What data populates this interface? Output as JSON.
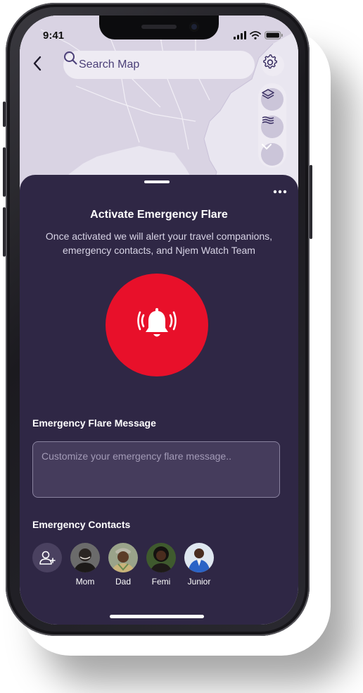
{
  "status": {
    "time": "9:41"
  },
  "header": {
    "search_placeholder": "Search Map",
    "icons": [
      "back-chevron-icon",
      "search-icon",
      "settings-gear-icon",
      "layers-icon",
      "wind-icon",
      "chevron-down-icon"
    ]
  },
  "sheet": {
    "title": "Activate Emergency Flare",
    "subtitle": "Once activated we will alert your travel companions, emergency contacts, and Njem Watch Team",
    "flare_icon": "alarm-bell-icon",
    "message_label": "Emergency Flare Message",
    "message_placeholder": "Customize your emergency flare message..",
    "contacts_label": "Emergency Contacts",
    "contacts": [
      {
        "name": "Mom"
      },
      {
        "name": "Dad"
      },
      {
        "name": "Femi"
      },
      {
        "name": "Junior"
      }
    ]
  },
  "colors": {
    "sheet_bg": "#2f2745",
    "flare_red": "#e8102a",
    "accent_purple": "#4b3f78"
  }
}
